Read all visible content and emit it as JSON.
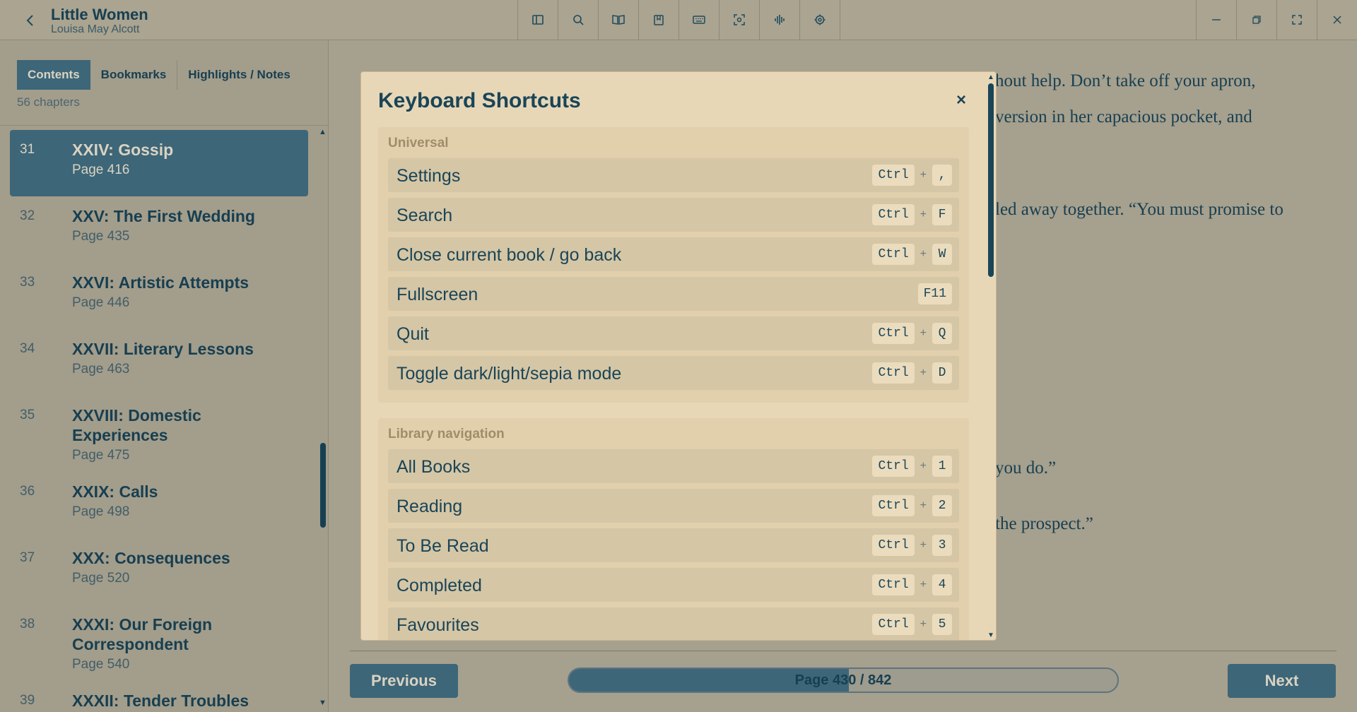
{
  "titlebar": {
    "book_title": "Little Women",
    "author": "Louisa May Alcott",
    "tools": [
      "sidebar-toggle-icon",
      "search-icon",
      "book-open-icon",
      "bookmark-icon",
      "keyboard-icon",
      "focus-icon",
      "audio-icon",
      "settings-gear-icon"
    ],
    "window_controls": [
      "minimize-icon",
      "restore-icon",
      "fullscreen-icon",
      "close-icon"
    ]
  },
  "sidebar": {
    "tabs": [
      "Contents",
      "Bookmarks",
      "Highlights / Notes"
    ],
    "chapter_count": "56 chapters",
    "chapters": [
      {
        "num": "31",
        "title": "XXIV: Gossip",
        "page": "Page 416"
      },
      {
        "num": "32",
        "title": "XXV: The First Wedding",
        "page": "Page 435"
      },
      {
        "num": "33",
        "title": "XXVI: Artistic Attempts",
        "page": "Page 446"
      },
      {
        "num": "34",
        "title": "XXVII: Literary Lessons",
        "page": "Page 463"
      },
      {
        "num": "35",
        "title": "XXVIII: Domestic Experiences",
        "page": "Page 475"
      },
      {
        "num": "36",
        "title": "XXIX: Calls",
        "page": "Page 498"
      },
      {
        "num": "37",
        "title": "XXX: Consequences",
        "page": "Page 520"
      },
      {
        "num": "38",
        "title": "XXXI: Our Foreign Correspondent",
        "page": "Page 540"
      },
      {
        "num": "39",
        "title": "XXXII: Tender Troubles",
        "page": ""
      }
    ]
  },
  "reader": {
    "lines": [
      "hout help. Don’t take off your apron,",
      "version in her capacious pocket, and",
      "led away together. “You must promise to",
      "you do.”",
      "the prospect.”"
    ],
    "previous": "Previous",
    "next": "Next",
    "page_label": "Page 430 / 842",
    "progress": 0.51
  },
  "modal": {
    "title": "Keyboard Shortcuts",
    "close": "×",
    "sections": [
      {
        "title": "Universal",
        "items": [
          {
            "label": "Settings",
            "keys": [
              "Ctrl",
              ","
            ]
          },
          {
            "label": "Search",
            "keys": [
              "Ctrl",
              "F"
            ]
          },
          {
            "label": "Close current book / go back",
            "keys": [
              "Ctrl",
              "W"
            ]
          },
          {
            "label": "Fullscreen",
            "keys": [
              "F11"
            ]
          },
          {
            "label": "Quit",
            "keys": [
              "Ctrl",
              "Q"
            ]
          },
          {
            "label": "Toggle dark/light/sepia mode",
            "keys": [
              "Ctrl",
              "D"
            ]
          }
        ]
      },
      {
        "title": "Library navigation",
        "items": [
          {
            "label": "All Books",
            "keys": [
              "Ctrl",
              "1"
            ]
          },
          {
            "label": "Reading",
            "keys": [
              "Ctrl",
              "2"
            ]
          },
          {
            "label": "To Be Read",
            "keys": [
              "Ctrl",
              "3"
            ]
          },
          {
            "label": "Completed",
            "keys": [
              "Ctrl",
              "4"
            ]
          },
          {
            "label": "Favourites",
            "keys": [
              "Ctrl",
              "5"
            ]
          }
        ]
      }
    ],
    "plus_sign": "+"
  }
}
